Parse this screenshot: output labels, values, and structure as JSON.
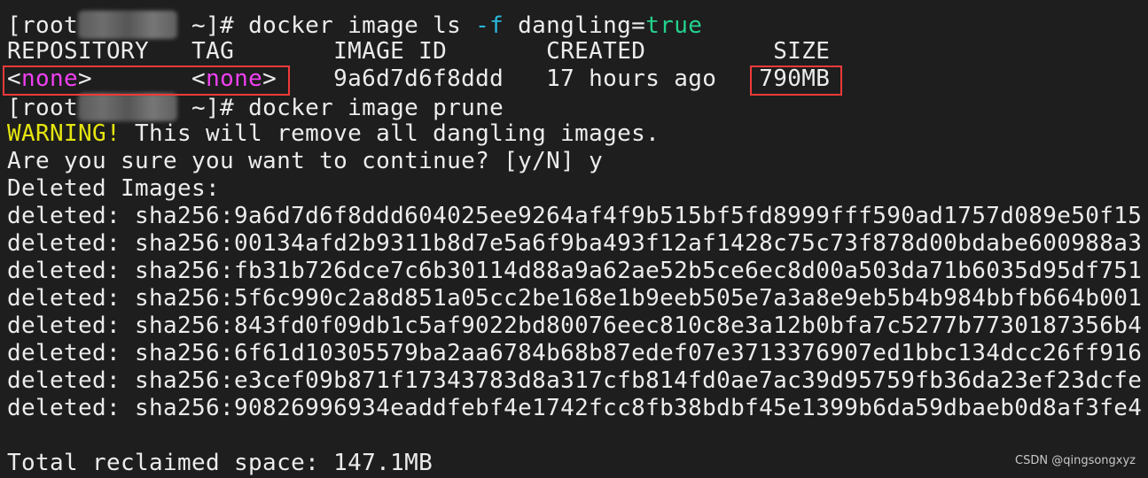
{
  "prompt1": {
    "prefix": "[root",
    "suffix": " ~]# ",
    "cmd": "docker image ls ",
    "flag": "-f",
    "arg": " dangling=",
    "value": "true"
  },
  "table": {
    "headers": [
      "REPOSITORY",
      "TAG",
      "IMAGE ID",
      "CREATED",
      "SIZE"
    ],
    "row": {
      "repository": "none",
      "tag": "none",
      "image_id": "9a6d7d6f8ddd",
      "created": "17 hours ago",
      "size": "790MB"
    }
  },
  "prompt2": {
    "prefix": "[root",
    "suffix": " ~]# ",
    "cmd": "docker image prune"
  },
  "warning": {
    "label": "WARNING!",
    "text": " This will remove all dangling images."
  },
  "confirm": "Are you sure you want to continue? [y/N] y",
  "deleted_header": "Deleted Images:",
  "deleted": [
    "deleted: sha256:9a6d7d6f8ddd604025ee9264af4f9b515bf5fd8999fff590ad1757d089e50f15",
    "deleted: sha256:00134afd2b9311b8d7e5a6f9ba493f12af1428c75c73f878d00bdabe600988a3",
    "deleted: sha256:fb31b726dce7c6b30114d88a9a62ae52b5ce6ec8d00a503da71b6035d95df751",
    "deleted: sha256:5f6c990c2a8d851a05cc2be168e1b9eeb505e7a3a8e9eb5b4b984bbfb664b001",
    "deleted: sha256:843fd0f09db1c5af9022bd80076eec810c8e3a12b0bfa7c5277b7730187356b4",
    "deleted: sha256:6f61d10305579ba2aa6784b68b87edef07e3713376907ed1bbc134dcc26ff916",
    "deleted: sha256:e3cef09b871f17343783d8a317cfb814fd0ae7ac39d95759fb36da23ef23dcfe",
    "deleted: sha256:90826996934eaddfebf4e1742fcc8fb38bdbf45e1399b6da59dbaeb0d8af3fe4"
  ],
  "total": "Total reclaimed space: 147.1MB",
  "watermark": "CSDN @qingsongxyz",
  "colors": {
    "background": "#1e1e1e",
    "text": "#ececec",
    "flag": "#29b8db",
    "true": "#23d18b",
    "none": "#f040f0",
    "warning": "#e5e510",
    "highlight_box": "#f03a3a"
  }
}
